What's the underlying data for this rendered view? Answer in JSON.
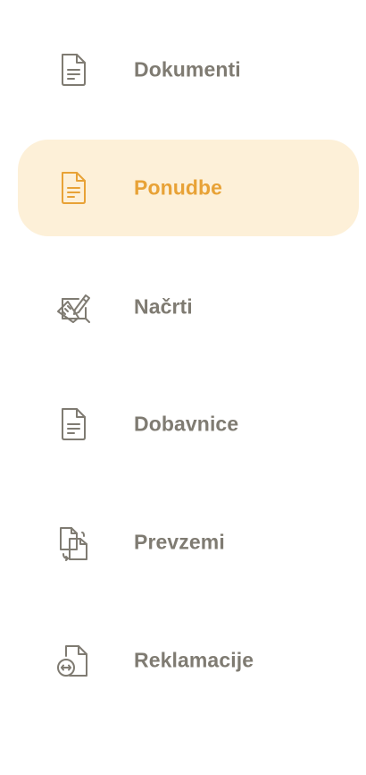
{
  "menu": {
    "items": [
      {
        "label": "Dokumenti",
        "icon": "document-icon",
        "active": false
      },
      {
        "label": "Ponudbe",
        "icon": "document-icon",
        "active": true
      },
      {
        "label": "Načrti",
        "icon": "plan-drawing-icon",
        "active": false
      },
      {
        "label": "Dobavnice",
        "icon": "document-icon",
        "active": false
      },
      {
        "label": "Prevzemi",
        "icon": "transfer-documents-icon",
        "active": false
      },
      {
        "label": "Reklamacije",
        "icon": "document-exchange-icon",
        "active": false
      }
    ]
  },
  "colors": {
    "text_default": "#7f7b72",
    "text_active": "#e8a236",
    "active_background": "#fdf0d8",
    "page_background": "#ffffff"
  }
}
